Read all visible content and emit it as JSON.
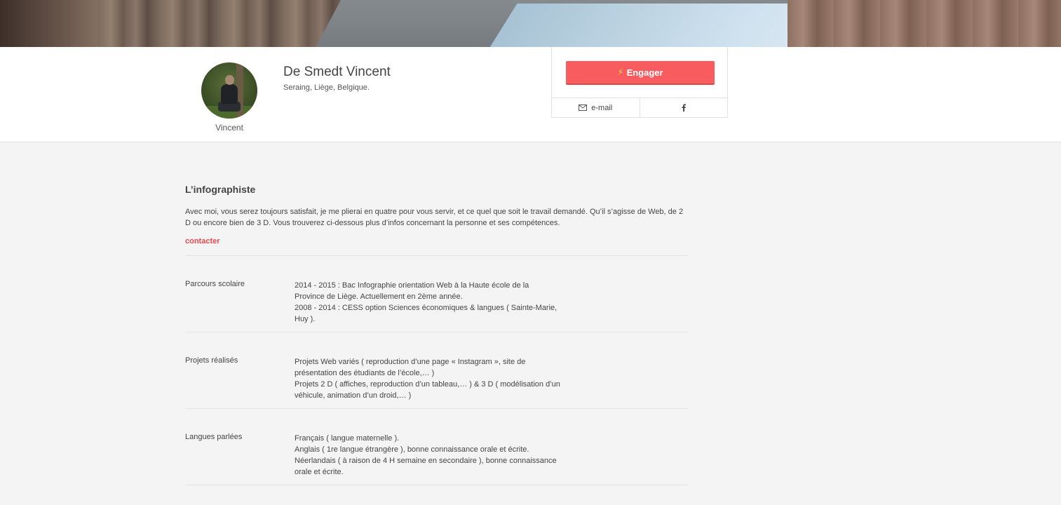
{
  "profile": {
    "avatar_caption": "Vincent",
    "name": "De Smedt Vincent",
    "location": "Seraing, Liège, Belgique."
  },
  "actions": {
    "engage_label": "Engager",
    "email_label": "e-mail",
    "engage_bolt_color": "#ffd54a",
    "accent_color": "#f95c5f"
  },
  "intro": {
    "title": "L’infographiste",
    "text": "Avec moi, vous serez toujours satisfait, je me plierai en quatre pour vous servir, et ce quel que soit le travail demandé. Qu’il s’agisse de Web, de 2 D ou encore bien de 3 D. Vous trouverez ci-dessous plus d’infos concernant la personne et ses compétences.",
    "contact_label": "contacter"
  },
  "details": [
    {
      "label": "Parcours scolaire",
      "lines": [
        "2014 - 2015 : Bac Infographie orientation Web à la Haute école de la",
        "Province de Liège. Actuellement en 2ème année.",
        "2008 - 2014 : CESS option Sciences économiques & langues ( Sainte-Marie,",
        "Huy )."
      ]
    },
    {
      "label": "Projets réalisés",
      "lines": [
        "Projets Web variés ( reproduction d’une page « Instagram », site de",
        "présentation des étudiants de l’école,… )",
        "Projets 2 D ( affiches, reproduction d’un tableau,… ) & 3 D ( modélisation d’un",
        "véhicule, animation d’un droid,… )"
      ]
    },
    {
      "label": "Langues parlées",
      "lines": [
        "Français ( langue maternelle ).",
        "Anglais ( 1re langue étrangère ), bonne connaissance orale et écrite.",
        "Néerlandais ( à raison de 4 H semaine en secondaire ), bonne connaissance",
        "orale et écrite."
      ]
    }
  ]
}
